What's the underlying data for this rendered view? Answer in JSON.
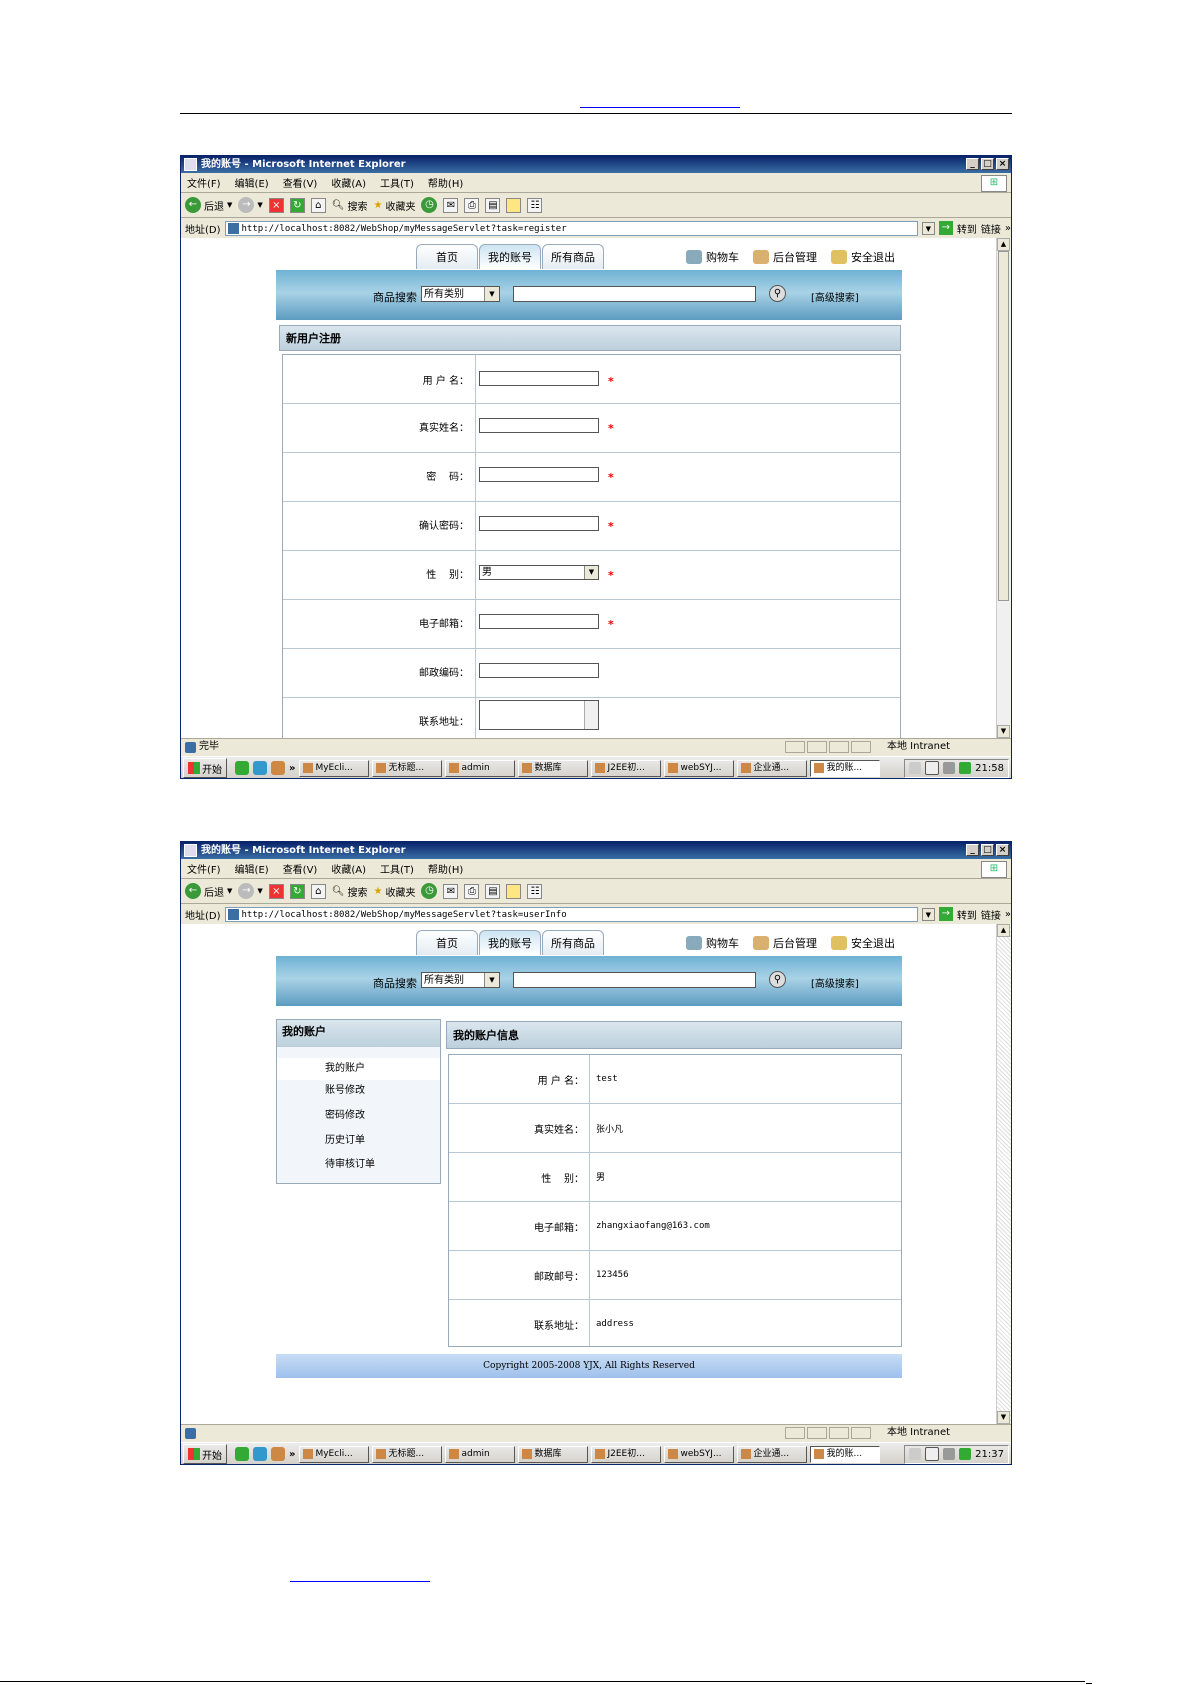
{
  "menu": [
    "文件(F)",
    "编辑(E)",
    "查看(V)",
    "收藏(A)",
    "工具(T)",
    "帮助(H)"
  ],
  "toolbar": {
    "back": "后退",
    "search": "搜索",
    "favorites": "收藏夹"
  },
  "addr_label": "地址(D)",
  "go_label": "转到",
  "links_label": "链接",
  "nav": {
    "tabs": [
      "首页",
      "我的账号",
      "所有商品"
    ],
    "cart": "购物车",
    "admin": "后台管理",
    "logout": "安全退出"
  },
  "search": {
    "label": "商品搜索",
    "category": "所有类别",
    "advanced": "[高级搜索]"
  },
  "window1": {
    "title": "我的账号 - Microsoft Internet Explorer",
    "url": "http://localhost:8082/WebShop/myMessageServlet?task=register",
    "status": "完毕",
    "panel_title": "新用户注册",
    "fields": [
      {
        "label": "用 户 名：",
        "required": "*"
      },
      {
        "label": "真实姓名：",
        "required": "*"
      },
      {
        "label": "密    码：",
        "required": "*"
      },
      {
        "label": "确认密码：",
        "required": "*"
      },
      {
        "label": "性    别：",
        "value": "男",
        "required": "*"
      },
      {
        "label": "电子邮箱：",
        "required": "*"
      },
      {
        "label": "邮政编码："
      },
      {
        "label": "联系地址："
      }
    ],
    "clock": "21:58"
  },
  "window2": {
    "title": "我的账号 - Microsoft Internet Explorer",
    "url": "http://localhost:8082/WebShop/myMessageServlet?task=userInfo",
    "status": "",
    "sidebar_title": "我的账户",
    "sidebar_items": [
      "我的账户",
      "账号修改",
      "密码修改",
      "历史订单",
      "待审核订单"
    ],
    "info_title": "我的账户信息",
    "info": [
      {
        "label": "用 户 名：",
        "value": "test"
      },
      {
        "label": "真实姓名：",
        "value": "张小凡"
      },
      {
        "label": "性    别：",
        "value": "男"
      },
      {
        "label": "电子邮箱：",
        "value": "zhangxiaofang@163.com"
      },
      {
        "label": "邮政邮号：",
        "value": "123456"
      },
      {
        "label": "联系地址：",
        "value": "address"
      }
    ],
    "copyright": "Copyright 2005-2008 YJX, All Rights Reserved",
    "clock": "21:37"
  },
  "statusbar": {
    "zone": "本地 Intranet"
  },
  "taskbar": {
    "start": "开始",
    "chevron": "»",
    "tasks": [
      "MyEcli...",
      "无标题...",
      "admin",
      "数据库",
      "J2EE初...",
      "webSYJ...",
      "企业通...",
      "我的账..."
    ]
  },
  "colors": {
    "title_bar": "#0a246a",
    "band": "#6fb2d4",
    "required": "#e00000"
  }
}
